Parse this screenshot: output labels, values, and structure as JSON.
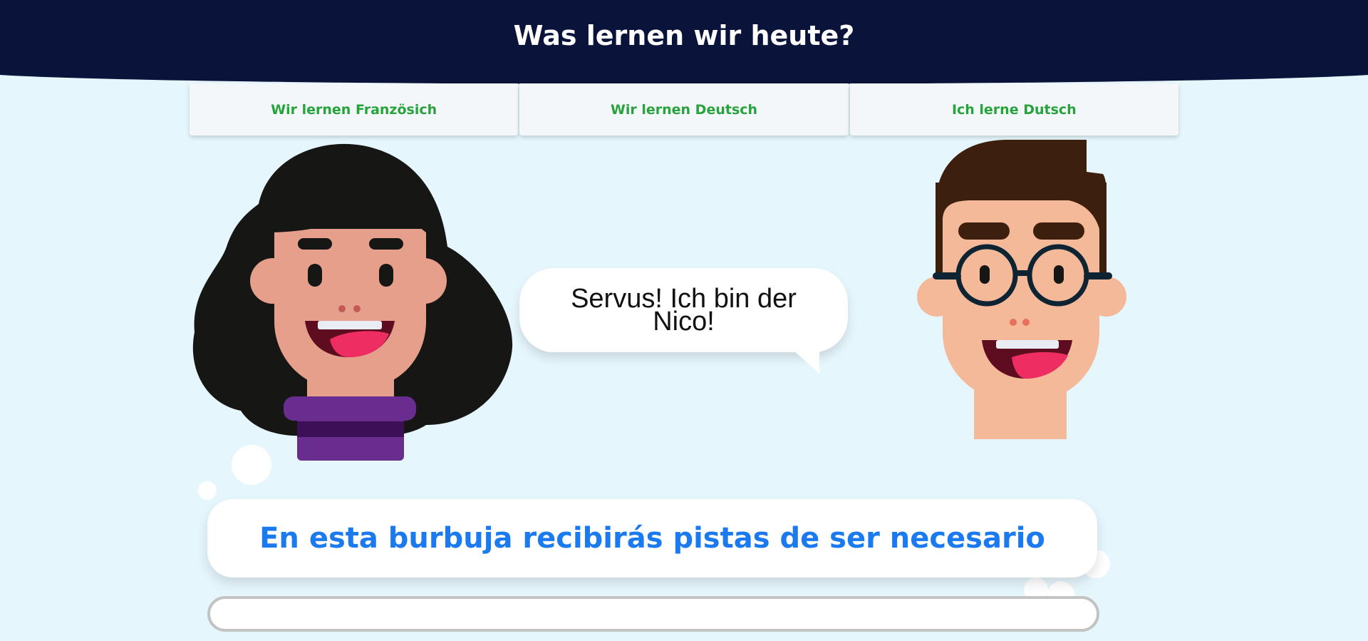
{
  "header": {
    "title": "Was lernen wir heute?"
  },
  "tabs": [
    {
      "label": "Wir lernen Französich"
    },
    {
      "label": "Wir lernen Deutsch"
    },
    {
      "label": "Ich lerne Dutsch"
    }
  ],
  "speech": {
    "text": "Servus! Ich bin der Nico!"
  },
  "hint": {
    "text": "En esta burbuja recibirás pistas de ser necesario"
  },
  "answer": {
    "value": "",
    "placeholder": ""
  },
  "colors": {
    "header_bg": "#0a1339",
    "page_bg": "#e5f6fc",
    "tab_text": "#27a33c",
    "hint_text": "#1b7af0"
  },
  "icons": {
    "left_character": "woman-avatar-icon",
    "right_character": "man-avatar-icon"
  }
}
